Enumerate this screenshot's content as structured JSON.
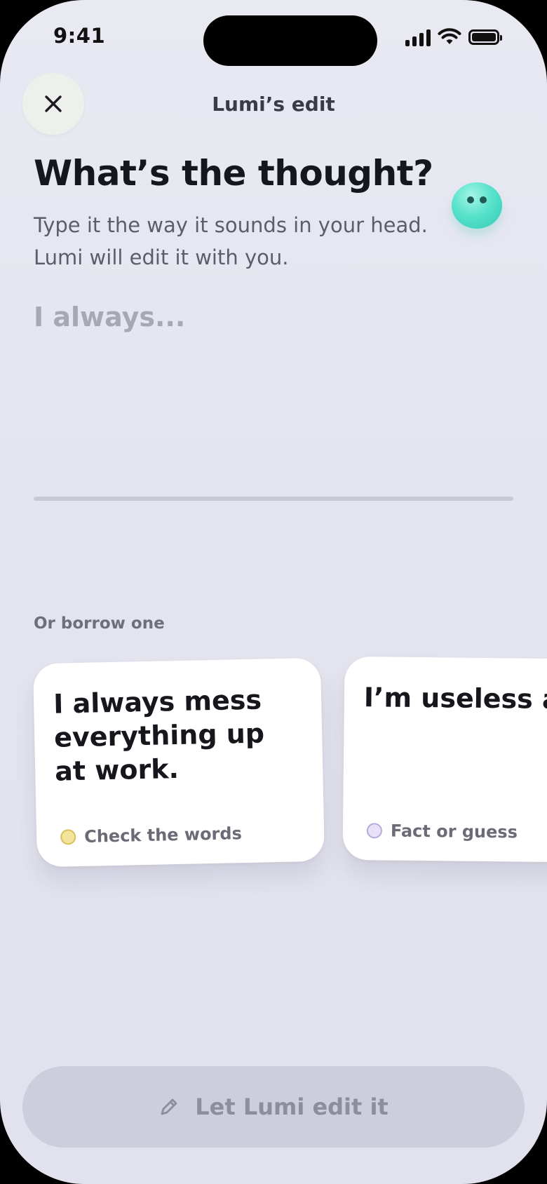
{
  "status_bar": {
    "time": "9:41"
  },
  "header": {
    "title": "Lumi’s edit",
    "close_icon": "close-icon"
  },
  "prompt": {
    "title": "What’s the thought?",
    "subtitle_line1": "Type it the way it sounds in your head.",
    "subtitle_line2": "Lumi will edit it with you.",
    "mascot": "lumi-mascot-icon"
  },
  "thought_input": {
    "placeholder": "I always...",
    "value": ""
  },
  "borrow": {
    "label": "Or borrow one",
    "cards": [
      {
        "text": "I always mess everything up at work.",
        "tag": "Check the words",
        "tag_color": "#f4e39a"
      },
      {
        "text": "I’m useless and everyone can tell.",
        "tag": "Fact or guess",
        "tag_color": "#e7e2f8"
      }
    ]
  },
  "cta": {
    "label": "Let Lumi edit it",
    "icon": "pencil-icon",
    "disabled": true
  },
  "colors": {
    "background": "#e6e6f0",
    "cta_bg": "#cdcedb",
    "accent_mascot": "#58e2cc"
  }
}
